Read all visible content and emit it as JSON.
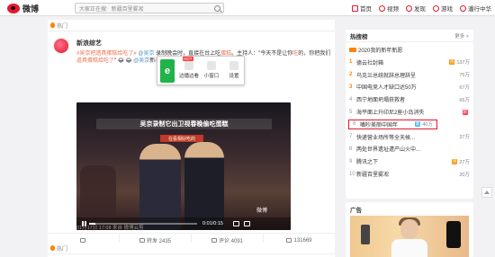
{
  "header": {
    "logo_text": "微博",
    "search_prefix": "大家正在搜:",
    "search_placeholder": "新疆百里雾凇",
    "nav": [
      {
        "label": "首页",
        "icon": "home-icon"
      },
      {
        "label": "视频",
        "icon": "video-icon"
      },
      {
        "label": "发现",
        "icon": "discover-icon"
      },
      {
        "label": "游戏",
        "icon": "game-icon"
      },
      {
        "label": "潘行中华",
        "icon": "user-icon"
      }
    ]
  },
  "feed": {
    "hot_label": "热门",
    "post": {
      "author": "新浪综艺",
      "text_parts": [
        {
          "t": "#吴京把遗具蛋糕给吃了#",
          "c": "link"
        },
        {
          "t": " ",
          "c": ""
        },
        {
          "t": "@吴京",
          "c": "blue"
        },
        {
          "t": " 录制晚会时，直接在台上吃",
          "c": ""
        },
        {
          "t": "蛋糕",
          "c": "link"
        },
        {
          "t": "。主持人：\"今天不是让你",
          "c": ""
        },
        {
          "t": "吃",
          "c": "link"
        },
        {
          "t": "的，你把我们",
          "c": ""
        },
        {
          "t": "道具蛋糕给吃了",
          "c": "link"
        },
        {
          "t": "\" 😂 😂 ",
          "c": ""
        },
        {
          "t": "@吴京",
          "c": "blue"
        },
        {
          "t": "新",
          "c": ""
        },
        {
          "t": "#新浪综艺的微博视频",
          "c": "link"
        }
      ],
      "video_title": "吴京录制它出卫视春晚偷吃蛋糕",
      "stage_sign": "在看相好吃的",
      "video_time": "0:01/0:15",
      "watermark": "微博",
      "progress": 0.06,
      "meta": "01月17日 17:08  来自 微博云剪",
      "actions": [
        {
          "label": "",
          "icon": "favorite-icon"
        },
        {
          "label": "转发 2435",
          "icon": "repost-icon"
        },
        {
          "label": "评论 4091",
          "icon": "comment-icon"
        },
        {
          "label": "131669",
          "icon": "like-icon"
        }
      ]
    },
    "popup": {
      "badge": "HOT",
      "items": [
        "边播边看",
        "小窗口",
        "设置"
      ]
    },
    "hot_label_2": "热门"
  },
  "hotlist": {
    "title": "热搜榜",
    "more": "更多 >",
    "rows": [
      {
        "rank": "",
        "text": "2020我的新年新愿",
        "count": "",
        "badge": "",
        "badge_color": ""
      },
      {
        "rank": "1",
        "text": "德云社封箱",
        "count": "137万",
        "badge": "热",
        "badge_color": "#ff9406"
      },
      {
        "rank": "2",
        "text": "乌克兰总统就辞总理辞呈",
        "count": "75万",
        "badge": "",
        "badge_color": ""
      },
      {
        "rank": "3",
        "text": "中国电竞人才缺口达50万",
        "count": "67万",
        "badge": "",
        "badge_color": ""
      },
      {
        "rank": "4",
        "text": "西宁地面坍塌获救者",
        "count": "65万",
        "badge": "",
        "badge_color": ""
      },
      {
        "rank": "5",
        "text": "海平面上升印尼2座小岛消失",
        "count": "",
        "badge": "新",
        "badge_color": "#ff3852"
      },
      {
        "rank": "6",
        "text": "嘴吵美丽中国年",
        "count": "40万",
        "badge": "新",
        "badge_color": "#49bff5"
      },
      {
        "rank": "7",
        "text": "快递营业场所等全天候...",
        "count": "37万",
        "badge": "",
        "badge_color": ""
      },
      {
        "rank": "8",
        "text": "两处世界遗址遭产山火中...",
        "count": "",
        "badge": "",
        "badge_color": ""
      },
      {
        "rank": "9",
        "text": "腾讯之下",
        "count": "27万",
        "badge": "热",
        "badge_color": "#ff9406"
      },
      {
        "rank": "10",
        "text": "新疆百里雾凇",
        "count": "20万",
        "badge": "",
        "badge_color": ""
      }
    ]
  },
  "ad": {
    "title": "广告"
  }
}
